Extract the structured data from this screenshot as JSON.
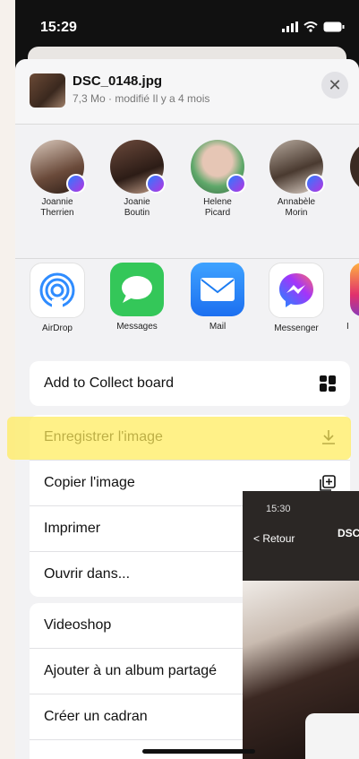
{
  "status": {
    "time": "15:29"
  },
  "file": {
    "name": "DSC_0148.jpg",
    "meta": "7,3 Mo · modifié Il y a 4 mois"
  },
  "people": [
    {
      "line1": "Joannie",
      "line2": "Therrien"
    },
    {
      "line1": "Joanie",
      "line2": "Boutin"
    },
    {
      "line1": "Helene",
      "line2": "Picard"
    },
    {
      "line1": "Annabèle",
      "line2": "Morin"
    }
  ],
  "apps": [
    {
      "label": "AirDrop",
      "icon": "airdrop-icon",
      "color": "#2f8cff"
    },
    {
      "label": "Messages",
      "icon": "messages-icon",
      "color": "#34c759"
    },
    {
      "label": "Mail",
      "icon": "mail-icon",
      "color": "#1c7cf2"
    },
    {
      "label": "Messenger",
      "icon": "messenger-icon",
      "color": "#a334fa"
    }
  ],
  "partial_app_label": "I",
  "actions": {
    "collect": "Add to Collect board",
    "save_image": "Enregistrer l'image",
    "copy_image": "Copier l'image",
    "print": "Imprimer",
    "open_in": "Ouvrir dans...",
    "videoshop": "Videoshop",
    "add_shared_album": "Ajouter à un album partagé",
    "create_face": "Créer un cadran"
  },
  "overlay": {
    "time": "15:30",
    "back": "< Retour",
    "title": "DSC"
  },
  "colors": {
    "highlight": "#ffeb5a",
    "accent": "#007aff"
  }
}
